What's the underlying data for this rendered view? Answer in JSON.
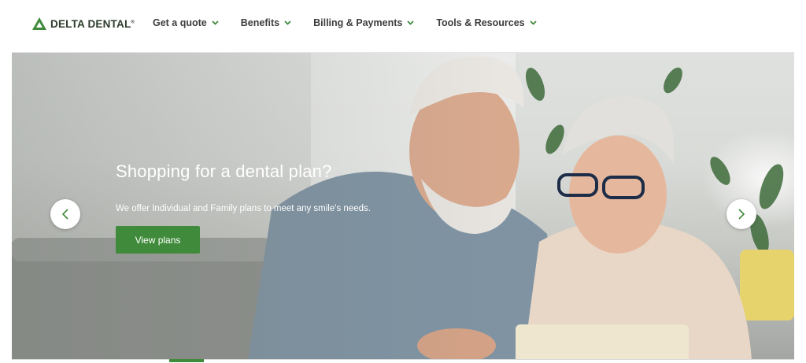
{
  "header": {
    "logo_text": "DELTA DENTAL",
    "logo_reg": "®",
    "nav": [
      {
        "label": "Get a quote",
        "icon": "chevron-down-icon"
      },
      {
        "label": "Benefits",
        "icon": "chevron-down-icon"
      },
      {
        "label": "Billing & Payments",
        "icon": "chevron-down-icon"
      },
      {
        "label": "Tools & Resources",
        "icon": "chevron-down-icon"
      }
    ]
  },
  "hero": {
    "title": "Shopping for a dental plan?",
    "subtitle": "We offer Individual and Family plans to meet any smile's needs.",
    "cta_label": "View plans",
    "prev_icon": "chevron-left-icon",
    "next_icon": "chevron-right-icon"
  },
  "colors": {
    "brand_green": "#3f8b3b",
    "nav_text": "#3c3c3c"
  }
}
